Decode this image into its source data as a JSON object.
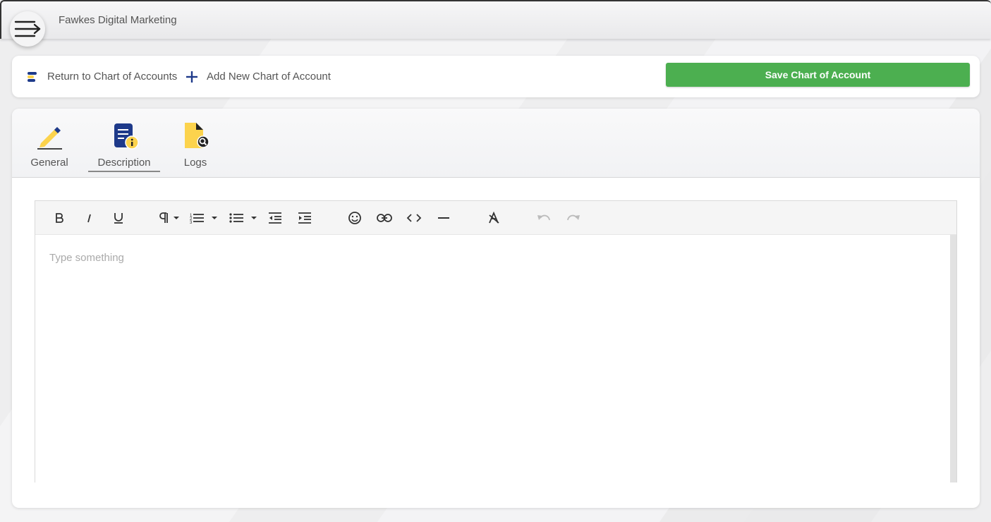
{
  "header": {
    "company_name": "Fawkes Digital Marketing",
    "menu_icon": "menu-arrow-icon"
  },
  "actions": {
    "return_label": "Return to Chart of Accounts",
    "add_label": "Add New Chart of Account",
    "save_label": "Save Chart of Account"
  },
  "tabs": [
    {
      "label": "General",
      "icon": "pencil-icon",
      "active": false
    },
    {
      "label": "Description",
      "icon": "document-info-icon",
      "active": true
    },
    {
      "label": "Logs",
      "icon": "file-search-icon",
      "active": false
    }
  ],
  "editor": {
    "placeholder": "Type something",
    "toolbar": [
      "bold",
      "italic",
      "underline",
      "paragraph-format",
      "ordered-list",
      "unordered-list",
      "outdent",
      "indent",
      "emoticons",
      "insert-link",
      "code-view",
      "horizontal-line",
      "clear-formatting",
      "undo",
      "redo"
    ]
  },
  "colors": {
    "save_button": "#4caf50",
    "accent_blue": "#1e3a8a",
    "accent_yellow": "#fcd34d"
  }
}
